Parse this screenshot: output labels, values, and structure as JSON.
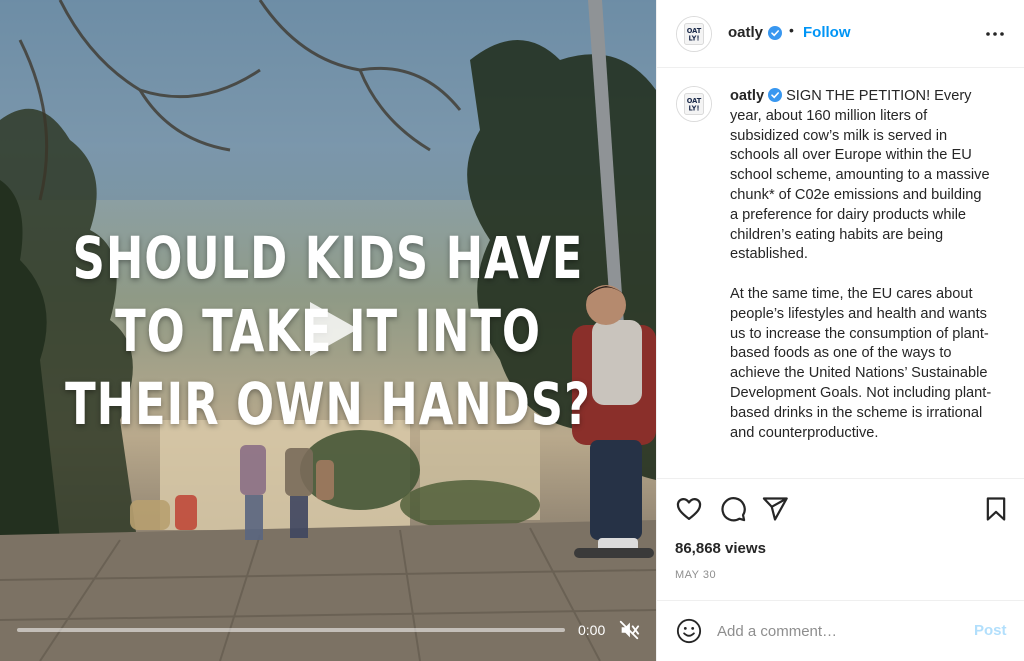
{
  "video": {
    "overlay_lines": [
      "SHOULD KIDS HAVE",
      "TO TAKE IT INTO",
      "THEIR OWN HANDS?"
    ],
    "time": "0:00",
    "progress": 0.0,
    "muted": true
  },
  "header": {
    "username": "oatly",
    "separator": "•",
    "follow_label": "Follow",
    "avatar_text": "OAT LY!"
  },
  "caption": {
    "username": "oatly",
    "paragraphs": [
      "SIGN THE PETITION! Every year, about 160 million liters of subsidized cow’s milk is served in schools all over Europe within the EU school scheme, amounting to a massive chunk* of C02e emissions and building a preference for dairy products while children’s eating habits are being established.",
      "At the same time, the EU cares about people’s lifestyles and health and wants us to increase the consumption of plant-based foods as one of the ways to achieve the United Nations’ Sustainable Development Goals. Not including plant-based drinks in the scheme is irrational and counterproductive."
    ]
  },
  "stats": {
    "views": "86,868 views",
    "date": "MAY 30"
  },
  "comment": {
    "placeholder": "Add a comment…",
    "post_label": "Post"
  },
  "colors": {
    "accent": "#0095f6",
    "post_disabled": "#b2dffc",
    "verified": "#3897f0",
    "muted_text": "#8e8e8e"
  },
  "icons": [
    "play-icon",
    "mute-icon",
    "more-icon",
    "verified-icon",
    "heart-icon",
    "comment-icon",
    "share-icon",
    "bookmark-icon",
    "emoji-icon"
  ]
}
